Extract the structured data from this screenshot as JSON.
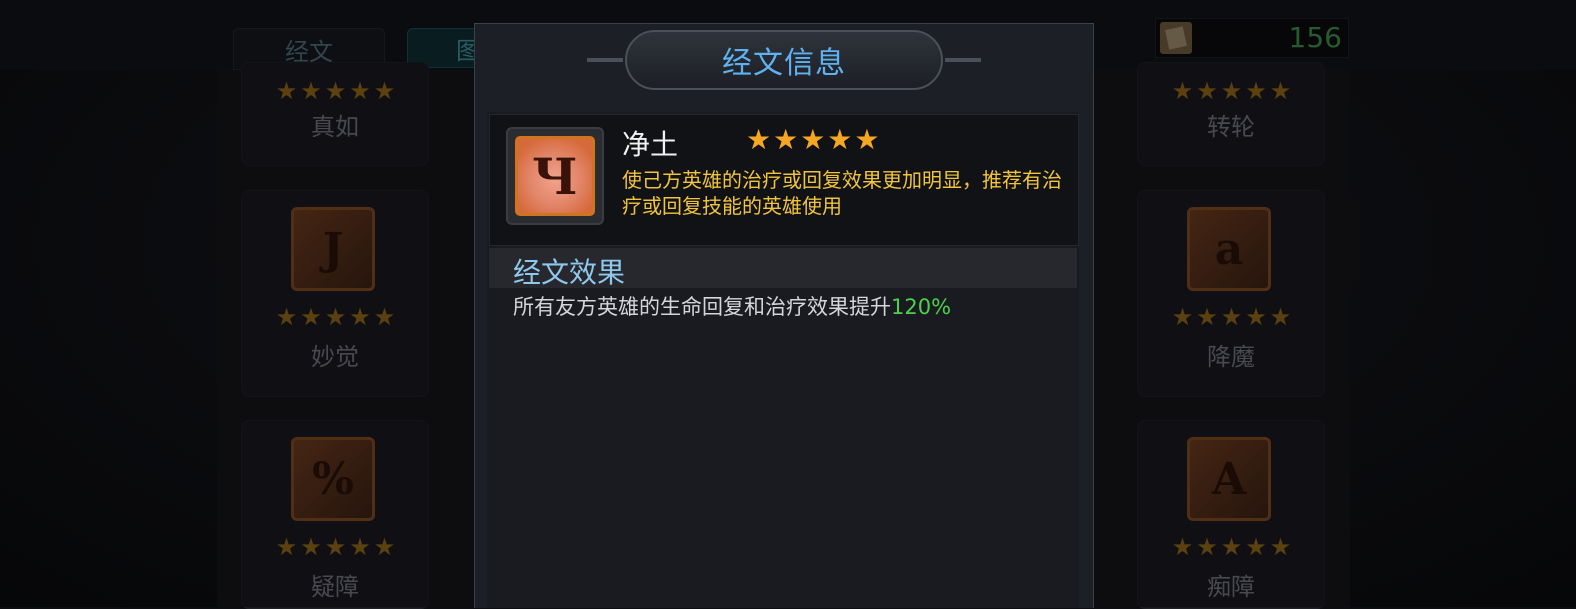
{
  "tabs": {
    "scripture": "经文",
    "codex": "图"
  },
  "currency": {
    "value": "156",
    "icon": "scroll-icon"
  },
  "left_cards": [
    {
      "name": "真如",
      "stars": "★★★★★",
      "icon": "rune-icon"
    },
    {
      "name": "妙觉",
      "stars": "★★★★★",
      "icon": "rune-icon"
    },
    {
      "name": "疑障",
      "stars": "★★★★★",
      "icon": "rune-icon"
    }
  ],
  "right_cards": [
    {
      "name": "转轮",
      "stars": "★★★★★",
      "icon": "rune-icon"
    },
    {
      "name": "降魔",
      "stars": "★★★★★",
      "icon": "rune-icon"
    },
    {
      "name": "痴障",
      "stars": "★★★★★",
      "icon": "rune-icon"
    }
  ],
  "dialog": {
    "title": "经文信息",
    "item": {
      "name": "净土",
      "stars": "★★★★★",
      "description": "使己方英雄的治疗或回复效果更加明显，推荐有治疗或回复技能的英雄使用",
      "icon": "sanskrit-rune-icon"
    },
    "section_title": "经文效果",
    "effect_text": "所有友方英雄的生命回复和治疗效果提升",
    "effect_value": "120%"
  },
  "colors": {
    "title": "#5fb2f2",
    "star": "#f5a623",
    "description": "#f1c43c",
    "highlight": "#4cd24a"
  }
}
